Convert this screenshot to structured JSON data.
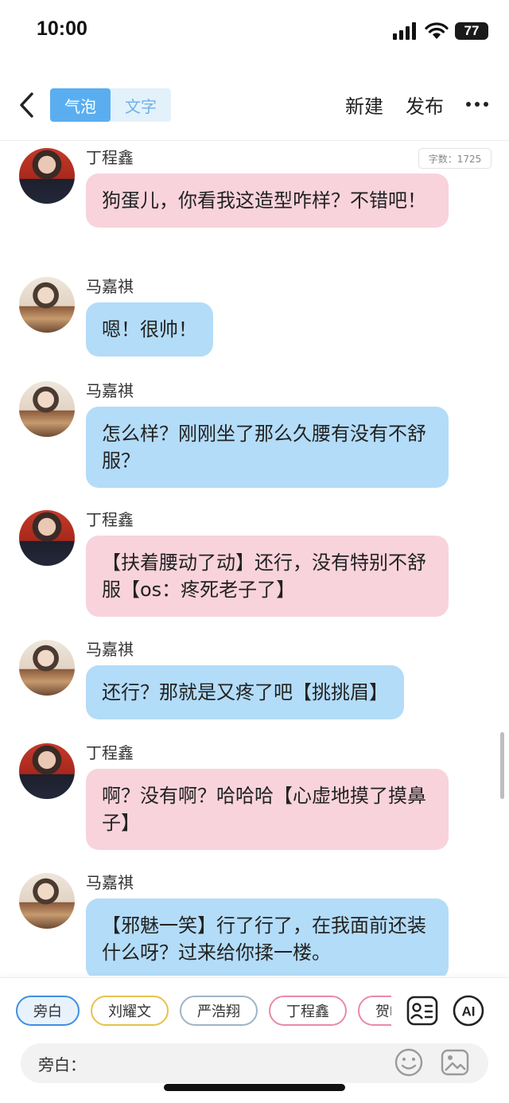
{
  "status_bar": {
    "time": "10:00",
    "battery": "77"
  },
  "nav": {
    "tabs": [
      {
        "label": "气泡",
        "active": true
      },
      {
        "label": "文字",
        "active": false
      }
    ],
    "new_label": "新建",
    "publish_label": "发布"
  },
  "word_count": "字数：1725",
  "messages": [
    {
      "sender": "丁程鑫",
      "text": "狗蛋儿，你看我这造型咋样？不错吧！",
      "color": "#f8d3dc"
    },
    {
      "sender": "马嘉祺",
      "text": "嗯！很帅！",
      "color": "#b3dcf8"
    },
    {
      "sender": "马嘉祺",
      "text": "怎么样？刚刚坐了那么久腰有没有不舒服？",
      "color": "#b3dcf8"
    },
    {
      "sender": "丁程鑫",
      "text": "【扶着腰动了动】还行，没有特别不舒服【os：疼死老子了】",
      "color": "#f8d3dc"
    },
    {
      "sender": "马嘉祺",
      "text": "还行？那就是又疼了吧【挑挑眉】",
      "color": "#b3dcf8"
    },
    {
      "sender": "丁程鑫",
      "text": "啊？没有啊？哈哈哈【心虚地摸了摸鼻子】",
      "color": "#f8d3dc"
    },
    {
      "sender": "马嘉祺",
      "text": "【邪魅一笑】行了行了，在我面前还装什么呀？过来给你揉一楼。",
      "color": "#b3dcf8"
    }
  ],
  "roles": [
    {
      "label": "旁白",
      "active": true,
      "border": "#3e8fe0"
    },
    {
      "label": "刘耀文",
      "active": false,
      "border": "#e6c24a"
    },
    {
      "label": "严浩翔",
      "active": false,
      "border": "#9fb3c8"
    },
    {
      "label": "丁程鑫",
      "active": false,
      "border": "#e98aa6"
    },
    {
      "label": "贺峻",
      "active": false,
      "border": "#e98aa6"
    }
  ],
  "input": {
    "label": "旁白："
  },
  "icons": {
    "back": "chevron-left-icon",
    "more": "more-horizontal-icon",
    "role_card": "contact-card-icon",
    "ai": "ai-icon",
    "emoji": "emoji-icon",
    "image": "image-icon"
  }
}
